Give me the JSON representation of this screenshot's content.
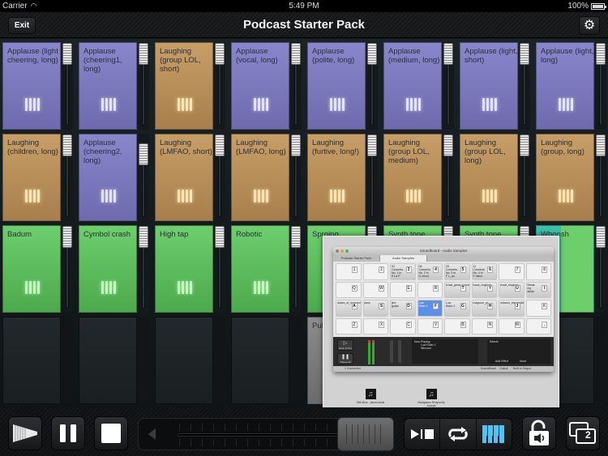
{
  "status_bar": {
    "carrier": "Carrier",
    "time": "5:49 PM",
    "battery": "100%"
  },
  "nav": {
    "exit_label": "Exit",
    "title": "Podcast Starter Pack",
    "settings_icon": "gear-icon"
  },
  "pads": [
    {
      "label": "Applause (light cheering, long)",
      "color": "purple"
    },
    {
      "label": "Applause (cheering1, long)",
      "color": "purple"
    },
    {
      "label": "Laughing (group LOL, short)",
      "color": "tan"
    },
    {
      "label": "Applause (vocal, long)",
      "color": "purple"
    },
    {
      "label": "Applause (polite, long)",
      "color": "purple"
    },
    {
      "label": "Applause (medium, long)",
      "color": "purple"
    },
    {
      "label": "Applause (light, short)",
      "color": "purple"
    },
    {
      "label": "Applause (light, long)",
      "color": "purple"
    },
    {
      "label": "Laughing (children, long)",
      "color": "tan"
    },
    {
      "label": "Applause (cheering2, long)",
      "color": "purple"
    },
    {
      "label": "Laughing (LMFAO, short)",
      "color": "tan"
    },
    {
      "label": "Laughing (LMFAO, long)",
      "color": "tan"
    },
    {
      "label": "Laughing (furtive, long!)",
      "color": "tan"
    },
    {
      "label": "Laughing (group LOL, medium)",
      "color": "tan"
    },
    {
      "label": "Laughing (group LOL, long)",
      "color": "tan"
    },
    {
      "label": "Laughing (group, long)",
      "color": "tan"
    },
    {
      "label": "Badum",
      "color": "green"
    },
    {
      "label": "Cymbol crash",
      "color": "green"
    },
    {
      "label": "High tap",
      "color": "green"
    },
    {
      "label": "Robotic",
      "color": "green"
    },
    {
      "label": "Sproing",
      "color": "green"
    },
    {
      "label": "Synth tone",
      "color": "green"
    },
    {
      "label": "Synth tone",
      "color": "green"
    },
    {
      "label": "Whoosh",
      "color": "teal"
    },
    {
      "label": "",
      "color": "empty"
    },
    {
      "label": "",
      "color": "empty"
    },
    {
      "label": "",
      "color": "empty"
    },
    {
      "label": "",
      "color": "empty"
    },
    {
      "label": "Pul (rh lon",
      "color": "gray"
    },
    {
      "label": "",
      "color": "empty"
    },
    {
      "label": "",
      "color": "empty"
    },
    {
      "label": "",
      "color": "empty"
    }
  ],
  "overlay": {
    "window_title": "Soundboard - Audio Samples",
    "tabs": [
      "Podcast Starter Pack",
      "Audio Samples"
    ],
    "keys": [
      {
        "key": "1",
        "label": ""
      },
      {
        "key": "2",
        "label": ""
      },
      {
        "key": "3",
        "label": "02 Concerto No. 1 in E La P"
      },
      {
        "key": "4",
        "label": "06 Concerto No. 2 in G minor"
      },
      {
        "key": "5",
        "label": "09 Concerto No. 3 in F L_ao"
      },
      {
        "key": "6",
        "label": "11 Concerto No. 4 in F minor"
      },
      {
        "key": "7",
        "label": ""
      },
      {
        "key": "8",
        "label": ""
      },
      {
        "key": "Q",
        "label": ""
      },
      {
        "key": "W",
        "label": ""
      },
      {
        "key": "E",
        "label": ""
      },
      {
        "key": "R",
        "label": ""
      },
      {
        "key": "T",
        "label": "borat_great_success"
      },
      {
        "key": "Y",
        "label": "borat_ringtone"
      },
      {
        "key": "U",
        "label": "borat_ringtone"
      },
      {
        "key": "I",
        "label": "Break my stride"
      },
      {
        "key": "A",
        "label": "dukes_of_hazzard"
      },
      {
        "key": "S",
        "label": "jaws"
      },
      {
        "key": "D",
        "label": "jimi guitar"
      },
      {
        "key": "F",
        "label": "Low Rider 1",
        "selected": true
      },
      {
        "key": "G",
        "label": "Low Rider 2"
      },
      {
        "key": "H",
        "label": "magnum_pi"
      },
      {
        "key": "J",
        "label": "mission_impossible"
      },
      {
        "key": "K",
        "label": ""
      },
      {
        "key": "Z",
        "label": ""
      },
      {
        "key": "X",
        "label": ""
      },
      {
        "key": "C",
        "label": ""
      },
      {
        "key": "V",
        "label": ""
      },
      {
        "key": "B",
        "label": ""
      },
      {
        "key": "N",
        "label": ""
      },
      {
        "key": "M",
        "label": ""
      },
      {
        "key": ",",
        "label": ""
      }
    ],
    "duck_label": "Duck (17%)",
    "pause_all_label": "Pause All",
    "now_playing_title": "Now Playing",
    "now_playing": [
      "Low Rider 1",
      "Whoosh"
    ],
    "effects_title": "Effects",
    "add_effect_label": "Add Effect",
    "effect_value": "None",
    "connected_label": "1 Connected",
    "soundflower_label": "Soundflower",
    "output_label": "Output",
    "output_value": "Built-in Output",
    "desktop_files": [
      "Still Alive - jazzsoundz",
      "Navigation Rhapsody Joseph"
    ]
  },
  "toolbar": {
    "fade_icon": "fade-out-icon",
    "pause_icon": "pause-icon",
    "stop_icon": "stop-icon",
    "volume_icon": "speaker-icon",
    "play_stop_icon": "play-stop-icon",
    "loop_icon": "loop-icon",
    "keyboard_icon": "piano-keys-icon",
    "lock_icon": "lock-audio-icon",
    "screens_badge": "2",
    "accent_color": "#4fc3f7"
  }
}
